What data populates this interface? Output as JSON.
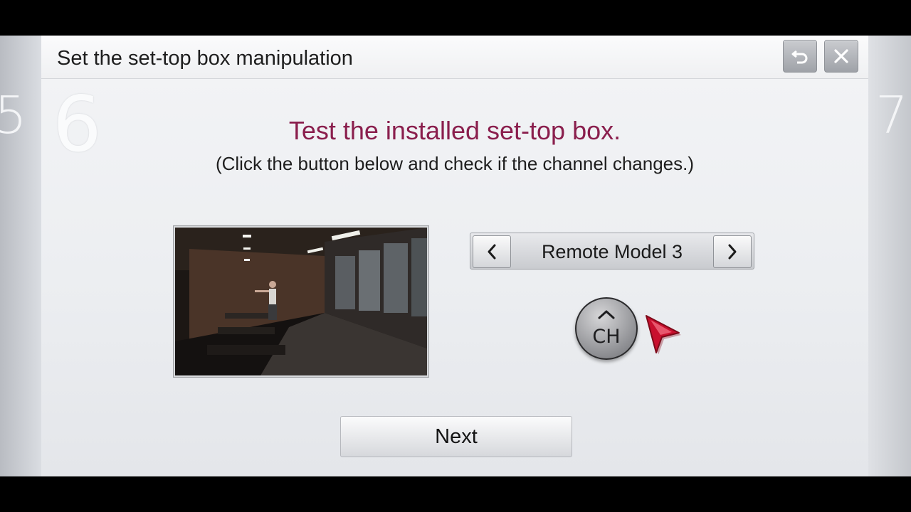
{
  "dialog": {
    "title": "Set the set-top box manipulation",
    "current_step": "6",
    "prev_step": "5",
    "next_step": "7",
    "heading": "Test the installed set-top box.",
    "subheading": "(Click the button below and check if the channel changes.)",
    "remote_selector": {
      "value": "Remote Model 3"
    },
    "channel_button": {
      "label": "CH"
    },
    "next_button_label": "Next"
  },
  "colors": {
    "heading": "#8a1f4d",
    "cursor": "#c8102e"
  },
  "icons": {
    "back": "back-arrow-icon",
    "close": "close-icon",
    "prev": "chevron-left-icon",
    "next": "chevron-right-icon",
    "channel_up": "chevron-up-icon",
    "cursor": "pointer-cursor-icon"
  }
}
